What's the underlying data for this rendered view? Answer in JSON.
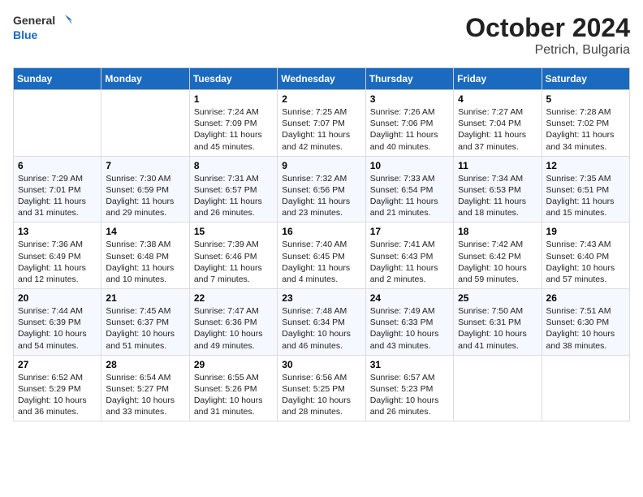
{
  "header": {
    "logo_general": "General",
    "logo_blue": "Blue",
    "month_title": "October 2024",
    "subtitle": "Petrich, Bulgaria"
  },
  "days_of_week": [
    "Sunday",
    "Monday",
    "Tuesday",
    "Wednesday",
    "Thursday",
    "Friday",
    "Saturday"
  ],
  "weeks": [
    [
      {
        "day": "",
        "info": ""
      },
      {
        "day": "",
        "info": ""
      },
      {
        "day": "1",
        "info": "Sunrise: 7:24 AM\nSunset: 7:09 PM\nDaylight: 11 hours and 45 minutes."
      },
      {
        "day": "2",
        "info": "Sunrise: 7:25 AM\nSunset: 7:07 PM\nDaylight: 11 hours and 42 minutes."
      },
      {
        "day": "3",
        "info": "Sunrise: 7:26 AM\nSunset: 7:06 PM\nDaylight: 11 hours and 40 minutes."
      },
      {
        "day": "4",
        "info": "Sunrise: 7:27 AM\nSunset: 7:04 PM\nDaylight: 11 hours and 37 minutes."
      },
      {
        "day": "5",
        "info": "Sunrise: 7:28 AM\nSunset: 7:02 PM\nDaylight: 11 hours and 34 minutes."
      }
    ],
    [
      {
        "day": "6",
        "info": "Sunrise: 7:29 AM\nSunset: 7:01 PM\nDaylight: 11 hours and 31 minutes."
      },
      {
        "day": "7",
        "info": "Sunrise: 7:30 AM\nSunset: 6:59 PM\nDaylight: 11 hours and 29 minutes."
      },
      {
        "day": "8",
        "info": "Sunrise: 7:31 AM\nSunset: 6:57 PM\nDaylight: 11 hours and 26 minutes."
      },
      {
        "day": "9",
        "info": "Sunrise: 7:32 AM\nSunset: 6:56 PM\nDaylight: 11 hours and 23 minutes."
      },
      {
        "day": "10",
        "info": "Sunrise: 7:33 AM\nSunset: 6:54 PM\nDaylight: 11 hours and 21 minutes."
      },
      {
        "day": "11",
        "info": "Sunrise: 7:34 AM\nSunset: 6:53 PM\nDaylight: 11 hours and 18 minutes."
      },
      {
        "day": "12",
        "info": "Sunrise: 7:35 AM\nSunset: 6:51 PM\nDaylight: 11 hours and 15 minutes."
      }
    ],
    [
      {
        "day": "13",
        "info": "Sunrise: 7:36 AM\nSunset: 6:49 PM\nDaylight: 11 hours and 12 minutes."
      },
      {
        "day": "14",
        "info": "Sunrise: 7:38 AM\nSunset: 6:48 PM\nDaylight: 11 hours and 10 minutes."
      },
      {
        "day": "15",
        "info": "Sunrise: 7:39 AM\nSunset: 6:46 PM\nDaylight: 11 hours and 7 minutes."
      },
      {
        "day": "16",
        "info": "Sunrise: 7:40 AM\nSunset: 6:45 PM\nDaylight: 11 hours and 4 minutes."
      },
      {
        "day": "17",
        "info": "Sunrise: 7:41 AM\nSunset: 6:43 PM\nDaylight: 11 hours and 2 minutes."
      },
      {
        "day": "18",
        "info": "Sunrise: 7:42 AM\nSunset: 6:42 PM\nDaylight: 10 hours and 59 minutes."
      },
      {
        "day": "19",
        "info": "Sunrise: 7:43 AM\nSunset: 6:40 PM\nDaylight: 10 hours and 57 minutes."
      }
    ],
    [
      {
        "day": "20",
        "info": "Sunrise: 7:44 AM\nSunset: 6:39 PM\nDaylight: 10 hours and 54 minutes."
      },
      {
        "day": "21",
        "info": "Sunrise: 7:45 AM\nSunset: 6:37 PM\nDaylight: 10 hours and 51 minutes."
      },
      {
        "day": "22",
        "info": "Sunrise: 7:47 AM\nSunset: 6:36 PM\nDaylight: 10 hours and 49 minutes."
      },
      {
        "day": "23",
        "info": "Sunrise: 7:48 AM\nSunset: 6:34 PM\nDaylight: 10 hours and 46 minutes."
      },
      {
        "day": "24",
        "info": "Sunrise: 7:49 AM\nSunset: 6:33 PM\nDaylight: 10 hours and 43 minutes."
      },
      {
        "day": "25",
        "info": "Sunrise: 7:50 AM\nSunset: 6:31 PM\nDaylight: 10 hours and 41 minutes."
      },
      {
        "day": "26",
        "info": "Sunrise: 7:51 AM\nSunset: 6:30 PM\nDaylight: 10 hours and 38 minutes."
      }
    ],
    [
      {
        "day": "27",
        "info": "Sunrise: 6:52 AM\nSunset: 5:29 PM\nDaylight: 10 hours and 36 minutes."
      },
      {
        "day": "28",
        "info": "Sunrise: 6:54 AM\nSunset: 5:27 PM\nDaylight: 10 hours and 33 minutes."
      },
      {
        "day": "29",
        "info": "Sunrise: 6:55 AM\nSunset: 5:26 PM\nDaylight: 10 hours and 31 minutes."
      },
      {
        "day": "30",
        "info": "Sunrise: 6:56 AM\nSunset: 5:25 PM\nDaylight: 10 hours and 28 minutes."
      },
      {
        "day": "31",
        "info": "Sunrise: 6:57 AM\nSunset: 5:23 PM\nDaylight: 10 hours and 26 minutes."
      },
      {
        "day": "",
        "info": ""
      },
      {
        "day": "",
        "info": ""
      }
    ]
  ]
}
